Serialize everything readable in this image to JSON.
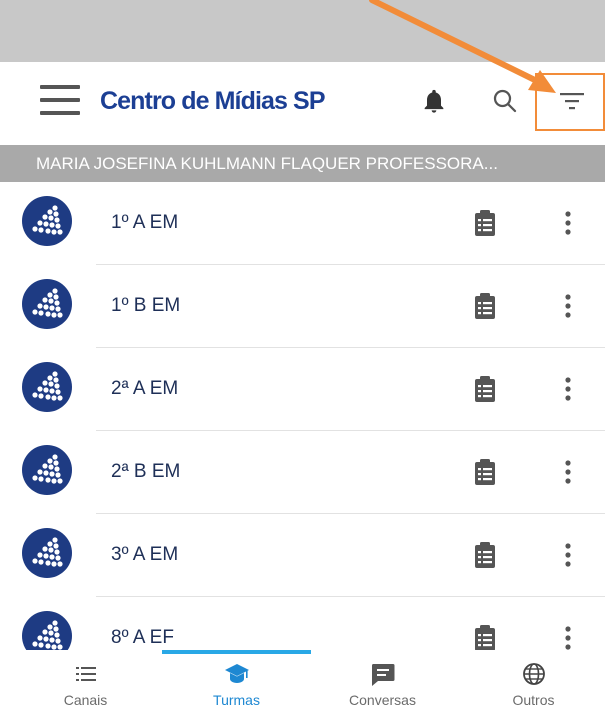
{
  "app_bar": {
    "title": "Centro de Mídias SP",
    "icons": [
      "menu-icon",
      "bell-icon",
      "search-icon",
      "filter-icon"
    ]
  },
  "section": {
    "header": "MARIA JOSEFINA KUHLMANN FLAQUER PROFESSORA..."
  },
  "classes": [
    {
      "name": "1º A EM"
    },
    {
      "name": "1º B EM"
    },
    {
      "name": "2ª A EM"
    },
    {
      "name": "2ª B EM"
    },
    {
      "name": "3º A EM"
    },
    {
      "name": "8º A EF"
    }
  ],
  "bottom_nav": {
    "tabs": [
      {
        "label": "Canais",
        "icon": "list-icon",
        "active": false
      },
      {
        "label": "Turmas",
        "icon": "graduation-cap-icon",
        "active": true
      },
      {
        "label": "Conversas",
        "icon": "chat-icon",
        "active": false
      },
      {
        "label": "Outros",
        "icon": "globe-icon",
        "active": false
      }
    ]
  },
  "colors": {
    "brand": "#1c3f94",
    "avatar": "#1e3b83",
    "highlight": "#f28c39",
    "active_tab": "#29a8e6",
    "header_bg": "#a9a9a9",
    "status_bar": "#c8c8c8"
  }
}
